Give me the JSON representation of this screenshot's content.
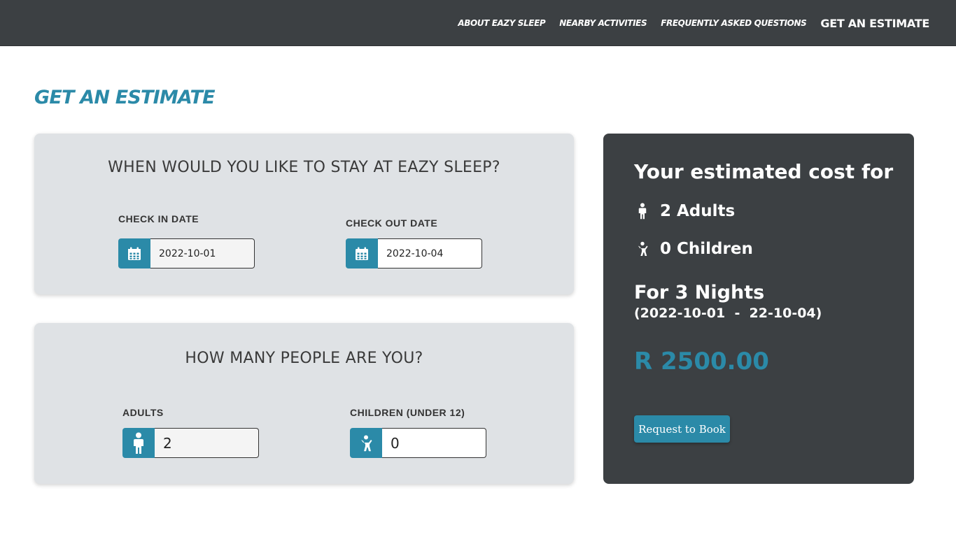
{
  "nav": {
    "links": [
      "ABOUT EAZY SLEEP",
      "NEARBY ACTIVITIES",
      "FREQUENTLY ASKED QUESTIONS",
      "GET AN ESTIMATE"
    ]
  },
  "page": {
    "title": "GET AN ESTIMATE"
  },
  "dates": {
    "heading": "WHEN WOULD YOU LIKE TO STAY AT EAZY SLEEP?",
    "check_in_label": "CHECK IN DATE",
    "check_in_value": "2022-10-01",
    "check_out_label": "CHECK OUT DATE",
    "check_out_value": "2022-10-04"
  },
  "people": {
    "heading": "HOW MANY PEOPLE ARE YOU?",
    "adults_label": "ADULTS",
    "adults_value": "2",
    "children_label": "CHILDREN (UNDER 12)",
    "children_value": "0"
  },
  "summary": {
    "title": "Your estimated cost for",
    "adults_text": "2 Adults",
    "children_text": "0 Children",
    "nights_text": "For 3 Nights",
    "range_text": "(2022-10-01  -  22-10-04)",
    "price": "R 2500.00",
    "book_label": "Request to Book"
  },
  "colors": {
    "accent": "#2b8aa8",
    "dark": "#3c4043",
    "card": "#dfe2e5"
  },
  "icons": [
    "calendar-icon",
    "adult-icon",
    "child-icon"
  ]
}
